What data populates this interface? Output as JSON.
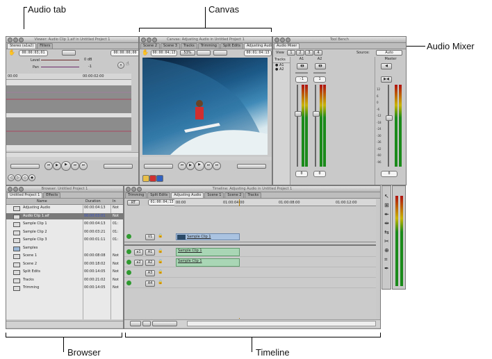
{
  "callouts": {
    "audio_tab": "Audio tab",
    "canvas": "Canvas",
    "audio_mixer": "Audio Mixer",
    "browser": "Browser",
    "timeline": "Timeline"
  },
  "viewer": {
    "title": "Viewer: Audio Clip 1.aif in Untitled Project 1",
    "tabs": [
      "Stereo (a1a2)",
      "Filters"
    ],
    "timecode_left": "00:00:03;01",
    "timecode_right": "00:00:00;00",
    "level_label": "Level",
    "level_value": "0 dB",
    "pan_label": "Pan",
    "pan_value": "-1",
    "ruler_start": "00:00",
    "ruler_mark": "00:00:02:00"
  },
  "canvas": {
    "title": "Canvas: Adjusting Audio in Untitled Project 1",
    "tabs": [
      "Scene 2",
      "Scene 3",
      "Tracks",
      "Trimming",
      "Split Edits",
      "Adjusting Audio"
    ],
    "timecode_left": "00:00:04;13",
    "zoom": "53%",
    "timecode_right": "00:01:04:13"
  },
  "mixer": {
    "title": "Tool Bench",
    "tab": "Audio Mixer",
    "view_label": "View",
    "view_buttons": [
      "1",
      "2",
      "3",
      "4"
    ],
    "source_label": "Source:",
    "source_value": "Auto",
    "tracks_label": "Tracks",
    "tracks": [
      "A1",
      "A2"
    ],
    "channels": [
      {
        "name": "A1",
        "pan": "-1",
        "level": "0"
      },
      {
        "name": "A2",
        "pan": "1",
        "level": "0"
      }
    ],
    "master_label": "Master",
    "master_level": "0",
    "scale": [
      "12",
      "6",
      "0",
      "-6",
      "-12",
      "-18",
      "-24",
      "-30",
      "-36",
      "-42",
      "-60",
      "-96"
    ]
  },
  "browser": {
    "title": "Browser: Untitled Project 1",
    "tabs": [
      "Untitled Project 1",
      "Effects"
    ],
    "columns": [
      "Name",
      "Duration",
      "In"
    ],
    "rows": [
      {
        "name": "Adjusting Audio",
        "duration": "00:00:04:13",
        "in": "Not",
        "selected": false
      },
      {
        "name": "Audio Clip 1.aif",
        "duration": "00:00:03:01",
        "in": "Not",
        "selected": true
      },
      {
        "name": "Sample Clip 1",
        "duration": "00:00:04:13",
        "in": "01:",
        "selected": false
      },
      {
        "name": "Sample Clip 2",
        "duration": "00:00:03:21",
        "in": "01:",
        "selected": false
      },
      {
        "name": "Sample Clip 3",
        "duration": "00:00:01:11",
        "in": "01:",
        "selected": false
      },
      {
        "name": "Samples",
        "duration": "",
        "in": "",
        "selected": false
      },
      {
        "name": "Scene 1",
        "duration": "00:00:08:08",
        "in": "Not",
        "selected": false
      },
      {
        "name": "Scene 2",
        "duration": "00:00:18:02",
        "in": "Not",
        "selected": false
      },
      {
        "name": "Split Edits",
        "duration": "00:00:14:05",
        "in": "Not",
        "selected": false
      },
      {
        "name": "Tracks",
        "duration": "00:00:21:02",
        "in": "Not",
        "selected": false
      },
      {
        "name": "Trimming",
        "duration": "00:00:14:05",
        "in": "Not",
        "selected": false
      }
    ]
  },
  "timeline": {
    "title": "Timeline: Adjusting Audio in Untitled Project 1",
    "tabs": [
      "Trimming",
      "Split Edits",
      "Adjusting Audio",
      "Scene 1",
      "Scene 2",
      "Tracks"
    ],
    "rt": "RT",
    "timecode": "01:00:04;13",
    "ruler": [
      "00:00",
      "01:00:04:00",
      "01:00:08:00",
      "01:00:12:00"
    ],
    "video_track": {
      "label": "V1",
      "clip": "Sample Clip 1"
    },
    "audio_tracks": [
      {
        "src": "a1",
        "label": "A1",
        "clip": "Sample Clip 1"
      },
      {
        "src": "a2",
        "label": "A2",
        "clip": "Sample Clip 1"
      },
      {
        "src": "",
        "label": "A3",
        "clip": ""
      },
      {
        "src": "",
        "label": "A4",
        "clip": ""
      }
    ]
  }
}
